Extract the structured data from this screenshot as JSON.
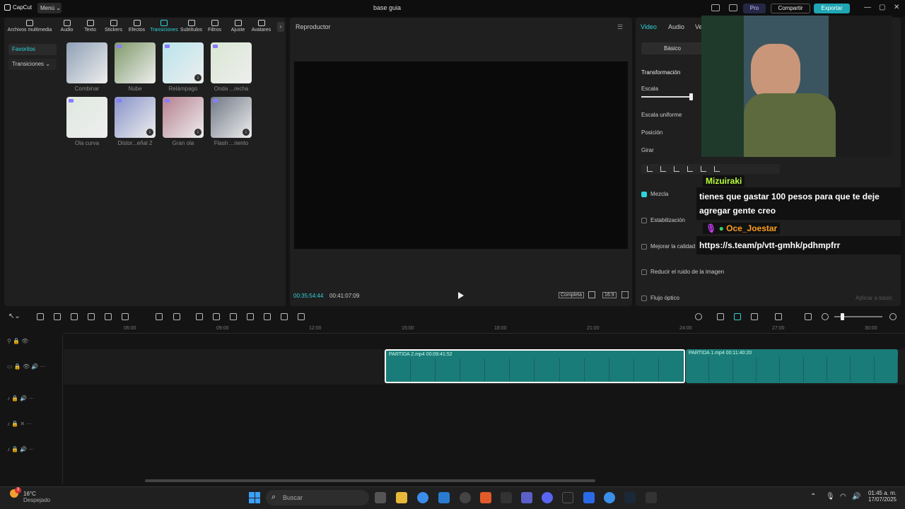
{
  "titlebar": {
    "logo_text": "CapCut",
    "menu_label": "Menú",
    "doc_title": "base guia",
    "pro_label": "Pro",
    "share_label": "Compartir",
    "export_label": "Exportar"
  },
  "tooltabs": [
    {
      "label": "Archivos multimedia",
      "icon": "media-icon"
    },
    {
      "label": "Audio",
      "icon": "audio-icon"
    },
    {
      "label": "Texto",
      "icon": "text-icon"
    },
    {
      "label": "Stickers",
      "icon": "sticker-icon"
    },
    {
      "label": "Efectos",
      "icon": "effects-icon"
    },
    {
      "label": "Transiciones",
      "icon": "transition-icon"
    },
    {
      "label": "Subtítulos",
      "icon": "subtitles-icon"
    },
    {
      "label": "Filtros",
      "icon": "filter-icon"
    },
    {
      "label": "Ajuste",
      "icon": "adjust-icon"
    },
    {
      "label": "Avatares",
      "icon": "avatar-icon"
    }
  ],
  "sidebar": {
    "favorites": "Favoritos",
    "transitions": "Transiciones"
  },
  "transitions": [
    {
      "label": "Combinar",
      "color": "#8fa0b5"
    },
    {
      "label": "Nube",
      "color": "#7f9a6a"
    },
    {
      "label": "Relámpago",
      "color": "#b8e4ec"
    },
    {
      "label": "Onda ...recha",
      "color": "#d9e6d2"
    },
    {
      "label": "Ola curva",
      "color": "#dfe8e0"
    },
    {
      "label": "Distor...eñal 2",
      "color": "#8893c9"
    },
    {
      "label": "Gran ola",
      "color": "#b58090"
    },
    {
      "label": "Flash ...riento",
      "color": "#707886"
    }
  ],
  "player": {
    "title": "Reproductor",
    "current_time": "00:35:54:44",
    "total_time": "00:41:07:09",
    "fit_label": "Completa",
    "ratio_label": "16:9"
  },
  "inspector": {
    "tabs": [
      "Video",
      "Audio",
      "Ve"
    ],
    "basic_label": "Básico",
    "transform": "Transformación",
    "scale": "Escala",
    "uniform_scale": "Escala uniforme",
    "position": "Posición",
    "rotate": "Girar",
    "blend": "Mezcla",
    "stabilization": "Estabilización",
    "improve_quality": "Mejorar la calidad",
    "reduce_noise": "Reducir el ruido de la imagen",
    "optical_flow": "Flujo óptico",
    "apply_basic": "Aplicar a básic"
  },
  "chat": [
    {
      "user": "Mizuiraki",
      "user_color": "#b6ff3a",
      "message": "tienes que gastar 100 pesos para que te deje agregar gente creo"
    },
    {
      "user": "Oce_Joestar",
      "user_color": "#ff9f1a",
      "message": "https://s.team/p/vtt-gmhk/pdhmpfrr"
    }
  ],
  "timeline": {
    "ruler": [
      "06:00",
      "09:00",
      "12:00",
      "15:00",
      "18:00",
      "21:00",
      "24:00",
      "27:00",
      "30:00"
    ],
    "clips": [
      {
        "name": "PARTIDA 2.mp4",
        "duration": "00:09:41:52"
      },
      {
        "name": "PARTIDA 1.mp4",
        "duration": "00:11:40:20"
      }
    ]
  },
  "taskbar": {
    "temp": "16°C",
    "weather": "Despejado",
    "notif_count": "3",
    "search_placeholder": "Buscar",
    "time": "01:45 a. m.",
    "date": "17/07/2025"
  }
}
